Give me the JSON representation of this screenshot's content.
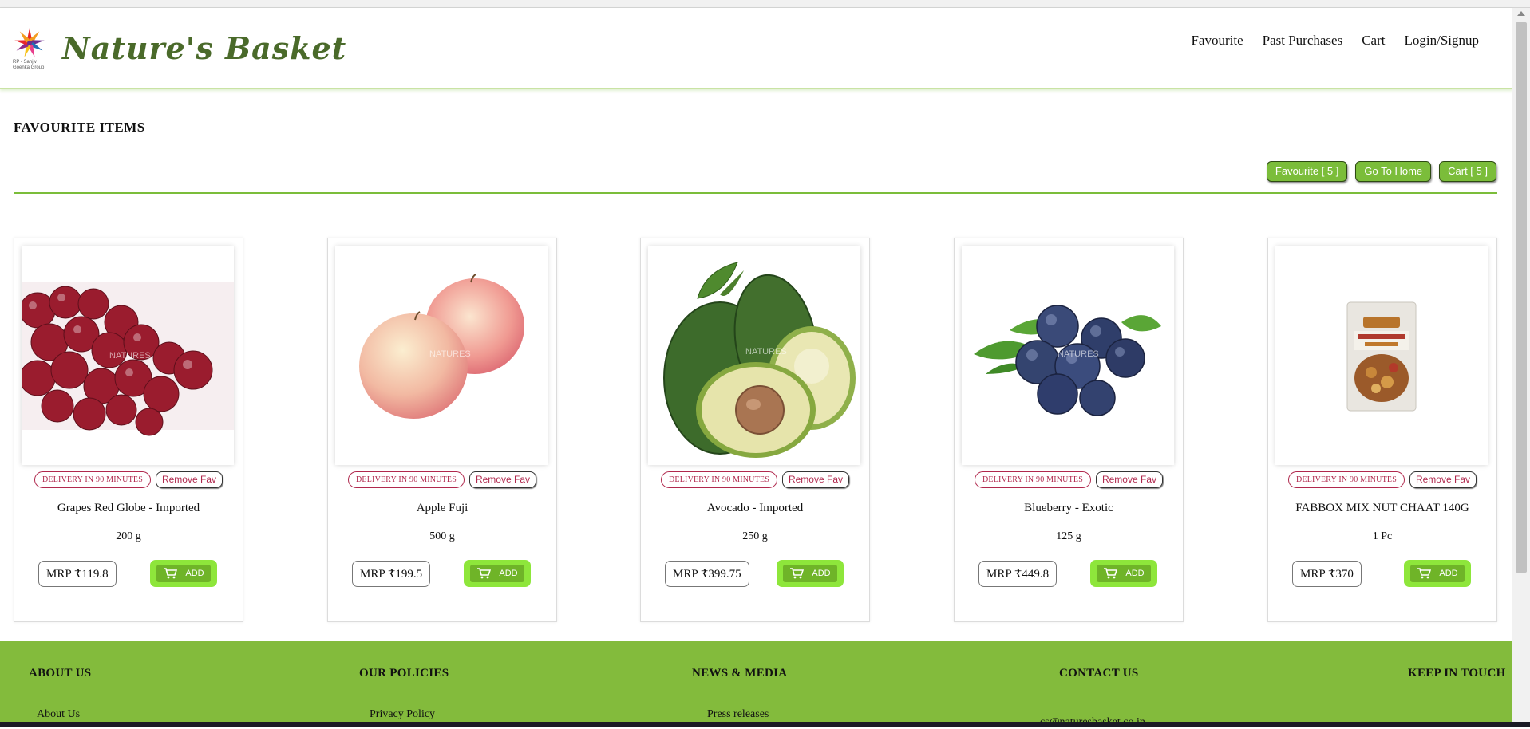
{
  "brand": {
    "name": "Nature's Basket",
    "subline": "RP - Sanjiv Goenka Group"
  },
  "nav": {
    "favourite": "Favourite",
    "past_purchases": "Past Purchases",
    "cart": "Cart",
    "login": "Login/Signup"
  },
  "page": {
    "title": "FAVOURITE ITEMS"
  },
  "actions": {
    "favourite": "Favourite [ 5 ]",
    "home": "Go To Home",
    "cart": "Cart [ 5 ]"
  },
  "labels": {
    "delivery": "DELIVERY IN 90 MINUTES",
    "remove_fav": "Remove Fav",
    "add": "ADD",
    "watermark": "NATURES"
  },
  "products": [
    {
      "name": "Grapes Red Globe - Imported",
      "qty": "200 g",
      "mrp": "MRP ₹119.8",
      "image": "red-grapes"
    },
    {
      "name": "Apple Fuji",
      "qty": "500 g",
      "mrp": "MRP ₹199.5",
      "image": "fuji-apples"
    },
    {
      "name": "Avocado - Imported",
      "qty": "250 g",
      "mrp": "MRP ₹399.75",
      "image": "avocado"
    },
    {
      "name": "Blueberry - Exotic",
      "qty": "125 g",
      "mrp": "MRP ₹449.8",
      "image": "blueberries"
    },
    {
      "name": "FABBOX MIX NUT CHAAT 140G",
      "qty": "1 Pc",
      "mrp": "MRP ₹370",
      "image": "snack-pack"
    }
  ],
  "footer": {
    "about_heading": "ABOUT US",
    "policies_heading": "OUR POLICIES",
    "news_heading": "NEWS & MEDIA",
    "contact_heading": "CONTACT US",
    "touch_heading": "KEEP IN TOUCH",
    "about_link": "About Us",
    "privacy_link": "Privacy Policy",
    "press_link": "Press releases",
    "email": "cs@naturesbasket.co.in"
  },
  "colors": {
    "accent_green": "#7bbd3a",
    "footer_green": "#83bb3c",
    "add_green": "#8ee63b",
    "delivery_red": "#b0284d",
    "brand_text": "#4a6a2a"
  }
}
